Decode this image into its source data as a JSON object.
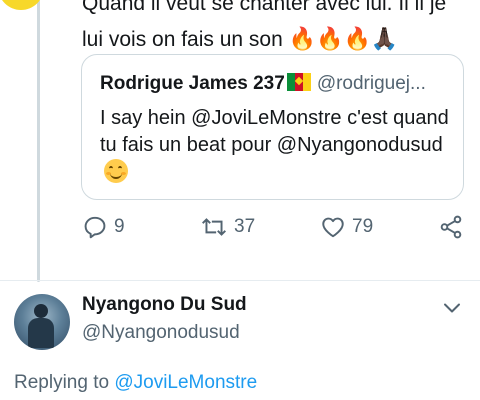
{
  "previous_tweet": {
    "text_line1": "Quand il veut se chanter avec lui. Il il je",
    "text_line2": "lui vois on fais un son",
    "emojis": [
      "🔥",
      "🔥",
      "🔥",
      "🙏🏿"
    ]
  },
  "quoted_tweet": {
    "name": "Rodrigue James 237",
    "flag": "cameroon-flag",
    "handle": "@rodriguej...",
    "body": "I say hein @JoviLeMonstre c'est quand tu fais un beat pour @Nyangonodusud",
    "emoji": "smiling-face-icon"
  },
  "actions": {
    "reply_count": "9",
    "retweet_count": "37",
    "like_count": "79"
  },
  "current_user": {
    "name": "Nyangono Du Sud",
    "handle": "@Nyangonodusud"
  },
  "replying": {
    "prefix": "Replying to ",
    "mention": "@JoviLeMonstre"
  },
  "colors": {
    "accent": "#1d9bf0",
    "secondary_text": "#536471",
    "border": "#cfd9de"
  }
}
